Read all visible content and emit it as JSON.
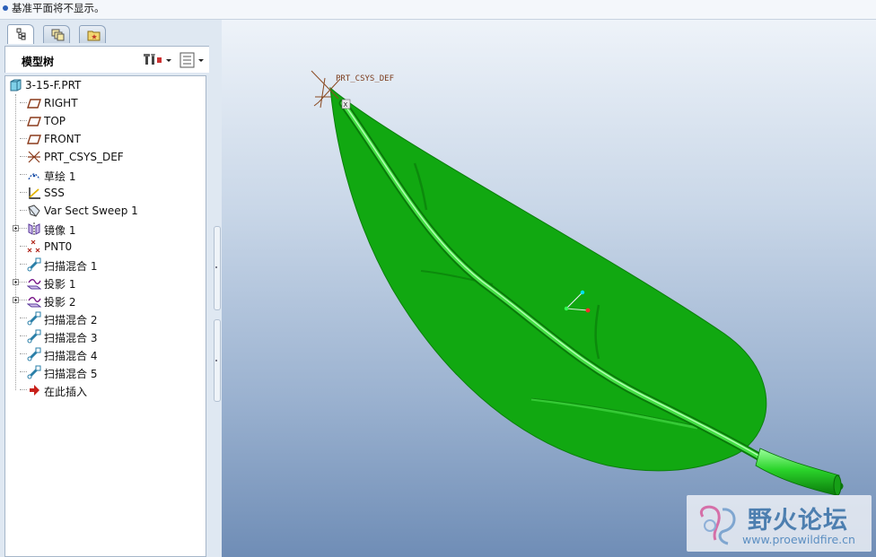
{
  "status": {
    "message": "基准平面将不显示。"
  },
  "nav_tabs": [
    {
      "name": "model-tree-tab",
      "icon": "model-tree-icon",
      "active": true
    },
    {
      "name": "layers-tab",
      "icon": "layers-icon",
      "active": false
    },
    {
      "name": "favorites-tab",
      "icon": "folder-star-icon",
      "active": false
    }
  ],
  "tree": {
    "title": "模型树",
    "settings_icon": "tree-settings-icon",
    "show_icon": "tree-show-icon",
    "root": {
      "label": "3-15-F.PRT",
      "icon": "part-icon"
    },
    "items": [
      {
        "label": "RIGHT",
        "icon": "datum-plane-icon",
        "expandable": false
      },
      {
        "label": "TOP",
        "icon": "datum-plane-icon",
        "expandable": false
      },
      {
        "label": "FRONT",
        "icon": "datum-plane-icon",
        "expandable": false
      },
      {
        "label": "PRT_CSYS_DEF",
        "icon": "coordinate-system-icon",
        "expandable": false
      },
      {
        "label": "草绘 1",
        "icon": "sketch-icon",
        "expandable": false
      },
      {
        "label": "SSS",
        "icon": "datum-curve-icon",
        "expandable": false
      },
      {
        "label": "Var Sect Sweep 1",
        "icon": "var-sect-sweep-icon",
        "expandable": false
      },
      {
        "label": "镜像 1",
        "icon": "mirror-icon",
        "expandable": true
      },
      {
        "label": "PNT0",
        "icon": "datum-point-icon",
        "expandable": false
      },
      {
        "label": "扫描混合 1",
        "icon": "swept-blend-icon",
        "expandable": false
      },
      {
        "label": "投影 1",
        "icon": "projection-icon",
        "expandable": true
      },
      {
        "label": "投影 2",
        "icon": "projection-icon",
        "expandable": true
      },
      {
        "label": "扫描混合 2",
        "icon": "swept-blend-icon",
        "expandable": false
      },
      {
        "label": "扫描混合 3",
        "icon": "swept-blend-icon",
        "expandable": false
      },
      {
        "label": "扫描混合 4",
        "icon": "swept-blend-icon",
        "expandable": false
      },
      {
        "label": "扫描混合 5",
        "icon": "swept-blend-icon",
        "expandable": false
      },
      {
        "label": "在此插入",
        "icon": "insert-here-arrow-icon",
        "expandable": false
      }
    ]
  },
  "viewport": {
    "csys_label": "PRT_CSYS_DEF",
    "axis_marker": "X",
    "model_color": "#11a811"
  },
  "watermark": {
    "title": "野火论坛",
    "url": "www.proewildfire.cn"
  }
}
